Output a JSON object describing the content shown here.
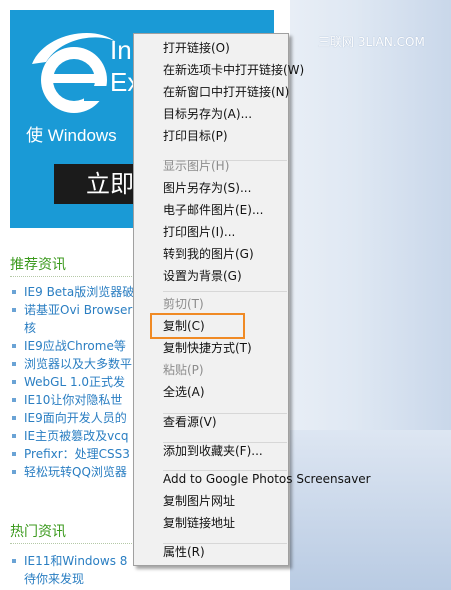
{
  "watermark": "三联网 3LIAN.COM",
  "colors": {
    "banner": "#1a9ad6",
    "link": "#2a7ec2",
    "section": "#3c9a1e",
    "highlight": "#f08a24"
  },
  "banner": {
    "title1": "In",
    "title2": "Ex",
    "subtitle": "使 Windows",
    "button": "立即"
  },
  "sections": [
    {
      "title": "推荐资讯",
      "items": [
        "IE9 Beta版浏览器破",
        "诺基亚Ovi Browser",
        "核",
        "IE9应战Chrome等",
        "浏览器以及大多数平",
        "WebGL 1.0正式发",
        "IE10让你对隐私世",
        "IE9面向开发人员的",
        "IE主页被篡改及vcq",
        "Prefixr：处理CSS3",
        "轻松玩转QQ浏览器"
      ]
    },
    {
      "title": "热门资讯",
      "items": [
        "IE11和Windows 8",
        "待你来发现"
      ]
    }
  ],
  "context_menu": {
    "groups": [
      [
        {
          "label": "打开链接(O)",
          "enabled": true
        },
        {
          "label": "在新选项卡中打开链接(W)",
          "enabled": true
        },
        {
          "label": "在新窗口中打开链接(N)",
          "enabled": true
        },
        {
          "label": "目标另存为(A)...",
          "enabled": true
        },
        {
          "label": "打印目标(P)",
          "enabled": true
        }
      ],
      [
        {
          "label": "显示图片(H)",
          "enabled": false
        },
        {
          "label": "图片另存为(S)...",
          "enabled": true
        },
        {
          "label": "电子邮件图片(E)...",
          "enabled": true
        },
        {
          "label": "打印图片(I)...",
          "enabled": true
        },
        {
          "label": "转到我的图片(G)",
          "enabled": true
        },
        {
          "label": "设置为背景(G)",
          "enabled": true
        }
      ],
      [
        {
          "label": "剪切(T)",
          "enabled": false
        },
        {
          "label": "复制(C)",
          "enabled": true,
          "highlighted": true
        },
        {
          "label": "复制快捷方式(T)",
          "enabled": true
        },
        {
          "label": "粘贴(P)",
          "enabled": false
        },
        {
          "label": "全选(A)",
          "enabled": true
        }
      ],
      [
        {
          "label": "查看源(V)",
          "enabled": true
        }
      ],
      [
        {
          "label": "添加到收藏夹(F)...",
          "enabled": true
        }
      ],
      [
        {
          "label": "Add to Google Photos Screensaver",
          "enabled": true
        },
        {
          "label": "复制图片网址",
          "enabled": true
        },
        {
          "label": "复制链接地址",
          "enabled": true
        }
      ],
      [
        {
          "label": "属性(R)",
          "enabled": true
        }
      ]
    ]
  }
}
